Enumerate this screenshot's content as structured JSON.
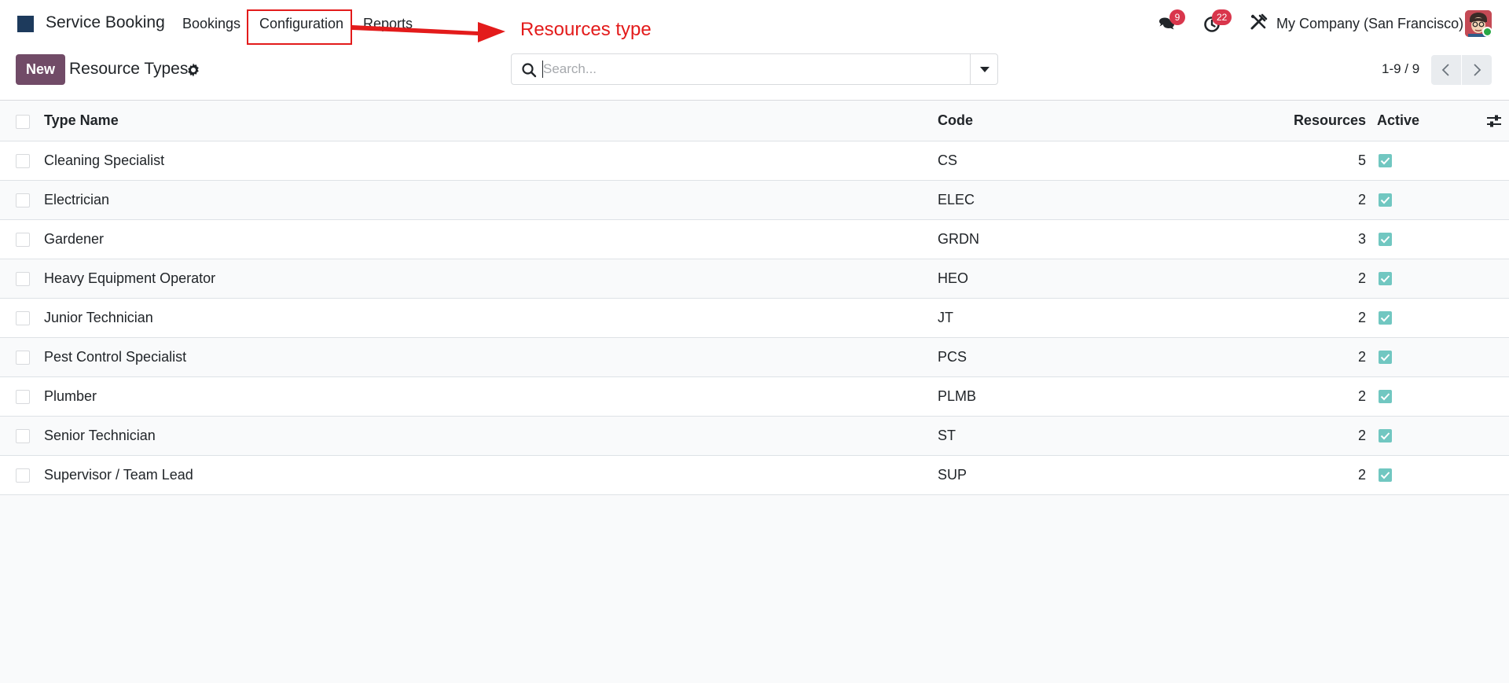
{
  "navbar": {
    "app_name": "Service Booking",
    "menu": {
      "bookings": "Bookings",
      "configuration": "Configuration",
      "reports": "Reports"
    },
    "annotation": "Resources type",
    "messages_count": "9",
    "activities_count": "22",
    "company": "My Company (San Francisco)"
  },
  "control_panel": {
    "new_label": "New",
    "title": "Resource Types",
    "search_placeholder": "Search...",
    "pager": "1-9 / 9"
  },
  "table": {
    "headers": {
      "name": "Type Name",
      "code": "Code",
      "resources": "Resources",
      "active": "Active"
    },
    "rows": [
      {
        "name": "Cleaning Specialist",
        "code": "CS",
        "resources": "5",
        "active": true
      },
      {
        "name": "Electrician",
        "code": "ELEC",
        "resources": "2",
        "active": true
      },
      {
        "name": "Gardener",
        "code": "GRDN",
        "resources": "3",
        "active": true
      },
      {
        "name": "Heavy Equipment Operator",
        "code": "HEO",
        "resources": "2",
        "active": true
      },
      {
        "name": "Junior Technician",
        "code": "JT",
        "resources": "2",
        "active": true
      },
      {
        "name": "Pest Control Specialist",
        "code": "PCS",
        "resources": "2",
        "active": true
      },
      {
        "name": "Plumber",
        "code": "PLMB",
        "resources": "2",
        "active": true
      },
      {
        "name": "Senior Technician",
        "code": "ST",
        "resources": "2",
        "active": true
      },
      {
        "name": "Supervisor / Team Lead",
        "code": "SUP",
        "resources": "2",
        "active": true
      }
    ]
  },
  "colors": {
    "brand": "#714b67",
    "annotation": "#e31b1b",
    "badge": "#d9364c",
    "active_check": "#71c7c1",
    "app_logo": "#1d3a5c"
  },
  "icons": {
    "logo": "app-logo-icon",
    "messages": "chat-bubbles-icon",
    "activities": "clock-icon",
    "debug": "tools-icon",
    "settings": "gear-icon",
    "search": "search-icon",
    "toggle": "caret-down-icon",
    "prev": "chevron-left-icon",
    "next": "chevron-right-icon",
    "optional_columns": "sliders-icon"
  }
}
